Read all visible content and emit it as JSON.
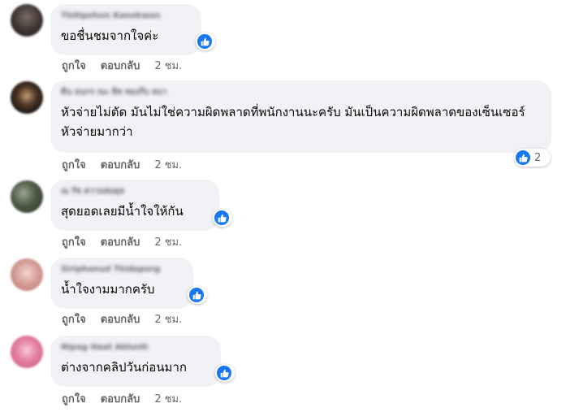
{
  "colors": {
    "accent": "#1877f2",
    "bubble": "#f0f2f5",
    "meta": "#65676b"
  },
  "icons": {
    "reaction": "like-icon"
  },
  "comments": [
    {
      "author": "Thitipohon Kanokwan",
      "text": "ขอชื่นชมจากใจค่ะ",
      "reaction_count": "",
      "like_label": "ถูกใจ",
      "reply_label": "ตอบกลับ",
      "time": "2 ชม."
    },
    {
      "author": "ดีน ธนกร ณะ สิท ทองกีบ ตบา",
      "text": "หัวจ่ายไม่ตัด มันไม่ใช่ความผิดพลาดที่พนักงานนะครับ มันเป็นความผิดพลาดของเซ็นเซอร์หัวจ่ายมากว่า",
      "reaction_count": "2",
      "like_label": "ถูกใจ",
      "reply_label": "ตอบกลับ",
      "time": "2 ชม."
    },
    {
      "author": "ณ รัช ความสมดุล",
      "text": "สุดยอดเลยมีน้ำใจให้กัน",
      "reaction_count": "",
      "like_label": "ถูกใจ",
      "reply_label": "ตอบกลับ",
      "time": "2 ชม."
    },
    {
      "author": "Siriphanud Thidaporg",
      "text": "น้ำใจงามมากครับ",
      "reaction_count": "",
      "like_label": "ถูกใจ",
      "reply_label": "ตอบกลับ",
      "time": "2 ชม."
    },
    {
      "author": "Nipag Haat Ablunti",
      "text": "ต่างจากคลิปวันก่อนมาก",
      "reaction_count": "",
      "like_label": "ถูกใจ",
      "reply_label": "ตอบกลับ",
      "time": "2 ชม."
    }
  ]
}
